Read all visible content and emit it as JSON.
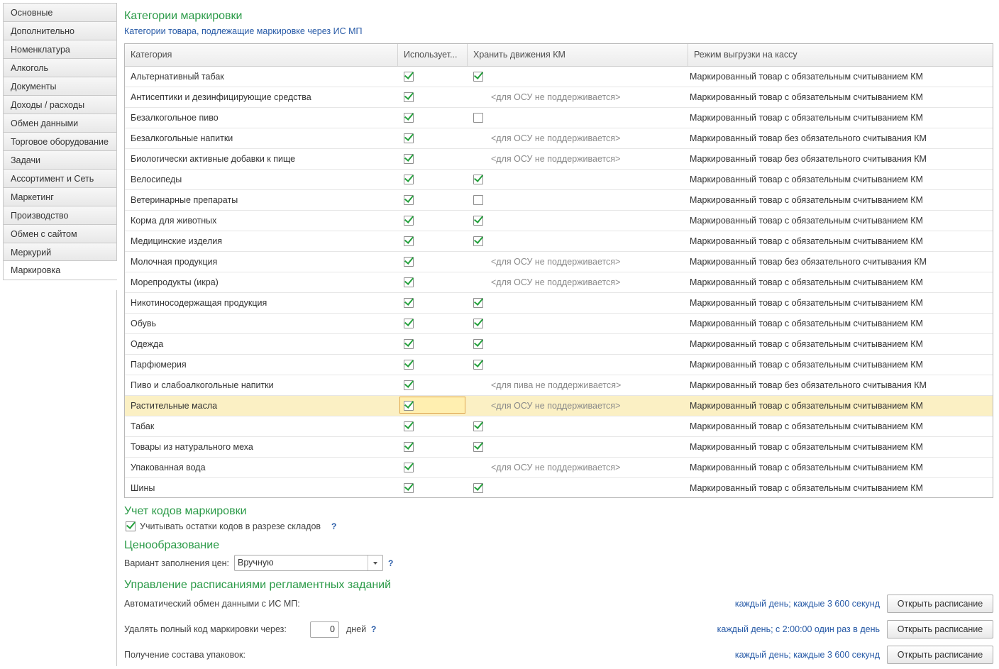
{
  "sidebar": {
    "items": [
      {
        "label": "Основные"
      },
      {
        "label": "Дополнительно"
      },
      {
        "label": "Номенклатура"
      },
      {
        "label": "Алкоголь"
      },
      {
        "label": "Документы"
      },
      {
        "label": "Доходы / расходы"
      },
      {
        "label": "Обмен данными"
      },
      {
        "label": "Торговое оборудование"
      },
      {
        "label": "Задачи"
      },
      {
        "label": "Ассортимент и Сеть"
      },
      {
        "label": "Маркетинг"
      },
      {
        "label": "Производство"
      },
      {
        "label": "Обмен с сайтом"
      },
      {
        "label": "Меркурий"
      },
      {
        "label": "Маркировка",
        "active": true
      }
    ]
  },
  "categories": {
    "title": "Категории маркировки",
    "subtitle": "Категории товара, подлежащие маркировке через ИС МП",
    "columns": [
      "Категория",
      "Используется",
      "Хранить движения КМ",
      "Режим выгрузки на кассу"
    ],
    "column_labels_shown": [
      "Категория",
      "Использует...",
      "Хранить движения КМ",
      "Режим выгрузки на кассу"
    ],
    "rows": [
      {
        "category": "Альтернативный табак",
        "used": true,
        "store": true,
        "store_note": "",
        "mode": "Маркированный товар с обязательным считыванием КМ"
      },
      {
        "category": "Антисептики и дезинфицирующие средства",
        "used": true,
        "store": null,
        "store_note": "<для ОСУ не поддерживается>",
        "mode": "Маркированный товар с обязательным считыванием КМ"
      },
      {
        "category": "Безалкогольное пиво",
        "used": true,
        "store": false,
        "store_note": "",
        "mode": "Маркированный товар с обязательным считыванием КМ"
      },
      {
        "category": "Безалкогольные напитки",
        "used": true,
        "store": null,
        "store_note": "<для ОСУ не поддерживается>",
        "mode": "Маркированный товар без обязательного считывания КМ"
      },
      {
        "category": "Биологически активные добавки к пище",
        "used": true,
        "store": null,
        "store_note": "<для ОСУ не поддерживается>",
        "mode": "Маркированный товар без обязательного считывания КМ"
      },
      {
        "category": "Велосипеды",
        "used": true,
        "store": true,
        "store_note": "",
        "mode": "Маркированный товар с обязательным считыванием КМ"
      },
      {
        "category": "Ветеринарные препараты",
        "used": true,
        "store": false,
        "store_note": "",
        "mode": "Маркированный товар с обязательным считыванием КМ"
      },
      {
        "category": "Корма для животных",
        "used": true,
        "store": true,
        "store_note": "",
        "mode": "Маркированный товар с обязательным считыванием КМ"
      },
      {
        "category": "Медицинские изделия",
        "used": true,
        "store": true,
        "store_note": "",
        "mode": "Маркированный товар с обязательным считыванием КМ"
      },
      {
        "category": "Молочная продукция",
        "used": true,
        "store": null,
        "store_note": "<для ОСУ не поддерживается>",
        "mode": "Маркированный товар без обязательного считывания КМ"
      },
      {
        "category": "Морепродукты (икра)",
        "used": true,
        "store": null,
        "store_note": "<для ОСУ не поддерживается>",
        "mode": "Маркированный товар с обязательным считыванием КМ"
      },
      {
        "category": "Никотиносодержащая продукция",
        "used": true,
        "store": true,
        "store_note": "",
        "mode": "Маркированный товар с обязательным считыванием КМ"
      },
      {
        "category": "Обувь",
        "used": true,
        "store": true,
        "store_note": "",
        "mode": "Маркированный товар с обязательным считыванием КМ"
      },
      {
        "category": "Одежда",
        "used": true,
        "store": true,
        "store_note": "",
        "mode": "Маркированный товар с обязательным считыванием КМ"
      },
      {
        "category": "Парфюмерия",
        "used": true,
        "store": true,
        "store_note": "",
        "mode": "Маркированный товар с обязательным считыванием КМ"
      },
      {
        "category": "Пиво и слабоалкогольные напитки",
        "used": true,
        "store": null,
        "store_note": "<для пива не поддерживается>",
        "mode": "Маркированный товар без обязательного считывания КМ"
      },
      {
        "category": "Растительные масла",
        "used": true,
        "store": null,
        "store_note": "<для ОСУ не поддерживается>",
        "mode": "Маркированный товар с обязательным считыванием КМ",
        "selected": true
      },
      {
        "category": "Табак",
        "used": true,
        "store": true,
        "store_note": "",
        "mode": "Маркированный товар с обязательным считыванием КМ"
      },
      {
        "category": "Товары из натурального меха",
        "used": true,
        "store": true,
        "store_note": "",
        "mode": "Маркированный товар с обязательным считыванием КМ"
      },
      {
        "category": "Упакованная вода",
        "used": true,
        "store": null,
        "store_note": "<для ОСУ не поддерживается>",
        "mode": "Маркированный товар с обязательным считыванием КМ"
      },
      {
        "category": "Шины",
        "used": true,
        "store": true,
        "store_note": "",
        "mode": "Маркированный товар с обязательным считыванием КМ"
      }
    ]
  },
  "codes": {
    "title": "Учет кодов маркировки",
    "checkbox_label": "Учитывать остатки кодов в разрезе складов",
    "checked": true,
    "help": "?"
  },
  "pricing": {
    "title": "Ценообразование",
    "label": "Вариант заполнения цен:",
    "value": "Вручную",
    "help": "?"
  },
  "schedules": {
    "title": "Управление расписаниями регламентных заданий",
    "items": [
      {
        "label": "Автоматический обмен данными с ИС МП:",
        "link": "каждый день; каждые 3 600 секунд",
        "button": "Открыть расписание"
      },
      {
        "label": "Удалять полный код маркировки через:",
        "days_value": "0",
        "days_unit": "дней",
        "help": "?",
        "link": "каждый день; с 2:00:00 один раз в день",
        "button": "Открыть расписание"
      },
      {
        "label": "Получение состава упаковок:",
        "link": "каждый день; каждые 3 600 секунд",
        "button": "Открыть расписание"
      }
    ]
  },
  "colors": {
    "heading_green": "#2a9a47",
    "link_blue": "#2659a6",
    "check_green": "#24a03c",
    "selected_row": "#fbf0c4"
  }
}
